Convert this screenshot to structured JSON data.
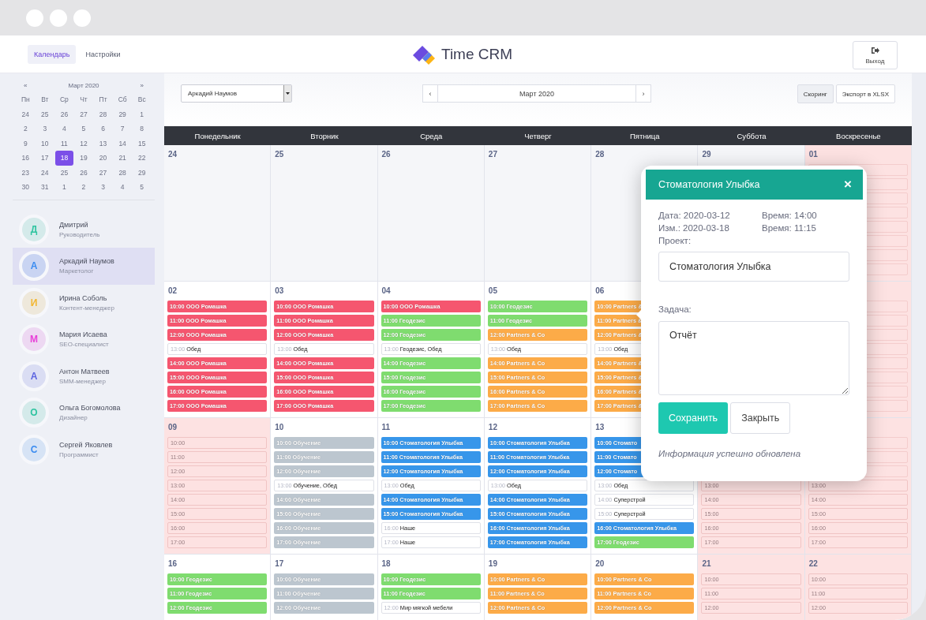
{
  "header": {
    "tabs": [
      {
        "label": "Календарь",
        "selected": true
      },
      {
        "label": "Настройки",
        "selected": false
      }
    ],
    "logo": "Time CRM",
    "exit": "Выход"
  },
  "sidebar": {
    "mini_calendar": {
      "prev": "«",
      "title": "Март 2020",
      "next": "»",
      "weekdays": [
        "Пн",
        "Вт",
        "Ср",
        "Чт",
        "Пт",
        "Сб",
        "Вс"
      ],
      "weeks": [
        [
          {
            "day": "24",
            "selected": false
          },
          {
            "day": "25",
            "selected": false
          },
          {
            "day": "26",
            "selected": false
          },
          {
            "day": "27",
            "selected": false
          },
          {
            "day": "28",
            "selected": false
          },
          {
            "day": "29",
            "selected": false
          },
          {
            "day": "1",
            "selected": false
          }
        ],
        [
          {
            "day": "2",
            "selected": false
          },
          {
            "day": "3",
            "selected": false
          },
          {
            "day": "4",
            "selected": false
          },
          {
            "day": "5",
            "selected": false
          },
          {
            "day": "6",
            "selected": false
          },
          {
            "day": "7",
            "selected": false
          },
          {
            "day": "8",
            "selected": false
          }
        ],
        [
          {
            "day": "9",
            "selected": false
          },
          {
            "day": "10",
            "selected": false
          },
          {
            "day": "11",
            "selected": false
          },
          {
            "day": "12",
            "selected": false
          },
          {
            "day": "13",
            "selected": false
          },
          {
            "day": "14",
            "selected": false
          },
          {
            "day": "15",
            "selected": false
          }
        ],
        [
          {
            "day": "16",
            "selected": false
          },
          {
            "day": "17",
            "selected": false
          },
          {
            "day": "18",
            "selected": true
          },
          {
            "day": "19",
            "selected": false
          },
          {
            "day": "20",
            "selected": false
          },
          {
            "day": "21",
            "selected": false
          },
          {
            "day": "22",
            "selected": false
          }
        ],
        [
          {
            "day": "23",
            "selected": false
          },
          {
            "day": "24",
            "selected": false
          },
          {
            "day": "25",
            "selected": false
          },
          {
            "day": "26",
            "selected": false
          },
          {
            "day": "27",
            "selected": false
          },
          {
            "day": "28",
            "selected": false
          },
          {
            "day": "29",
            "selected": false
          }
        ],
        [
          {
            "day": "30",
            "selected": false
          },
          {
            "day": "31",
            "selected": false
          },
          {
            "day": "1",
            "selected": false
          },
          {
            "day": "2",
            "selected": false
          },
          {
            "day": "3",
            "selected": false
          },
          {
            "day": "4",
            "selected": false
          },
          {
            "day": "5",
            "selected": false
          }
        ]
      ]
    },
    "users": [
      {
        "initial": "Д",
        "name": "Дмитрий",
        "role": "Руководитель",
        "color": "#2ec4a0",
        "selected": false
      },
      {
        "initial": "А",
        "name": "Аркадий Наумов",
        "role": "Маркетолог",
        "color": "#3b8cf0",
        "selected": true
      },
      {
        "initial": "И",
        "name": "Ирина Соболь",
        "role": "Контент-менеджер",
        "color": "#f2b630",
        "selected": false
      },
      {
        "initial": "М",
        "name": "Мария Исаева",
        "role": "SEO-специалист",
        "color": "#e83fd8",
        "selected": false
      },
      {
        "initial": "А",
        "name": "Антон Матвеев",
        "role": "SMM-менеджер",
        "color": "#5b63e0",
        "selected": false
      },
      {
        "initial": "О",
        "name": "Ольга Богомолова",
        "role": "Дизайнер",
        "color": "#2ec4a0",
        "selected": false
      },
      {
        "initial": "С",
        "name": "Сергей Яковлев",
        "role": "Программист",
        "color": "#3b8cf0",
        "selected": false
      }
    ]
  },
  "toolbar": {
    "user_select": "Аркадий Наумов",
    "month_prev": "‹",
    "month": "Март 2020",
    "month_next": "›",
    "buttons": [
      {
        "label": "Скоринг",
        "selected": true
      },
      {
        "label": "Экспорт в XLSX",
        "selected": false
      }
    ]
  },
  "calendar": {
    "weekdays": [
      "Понедельник",
      "Вторник",
      "Среда",
      "Четверг",
      "Пятница",
      "Суббота",
      "Воскресенье"
    ],
    "weeks": [
      {
        "days": [
          {
            "number": "24",
            "kind": "past"
          },
          {
            "number": "25",
            "kind": "past"
          },
          {
            "number": "26",
            "kind": "past"
          },
          {
            "number": "27",
            "kind": "past"
          },
          {
            "number": "28",
            "kind": "past"
          },
          {
            "number": "29",
            "kind": "past"
          },
          {
            "number": "01",
            "kind": "off",
            "events": [
              {
                "kind": "blank"
              },
              {
                "kind": "blank"
              },
              {
                "kind": "blank"
              },
              {
                "kind": "blank"
              },
              {
                "kind": "blank"
              },
              {
                "kind": "blank"
              },
              {
                "kind": "blank"
              },
              {
                "kind": "blank"
              }
            ]
          }
        ]
      },
      {
        "days": [
          {
            "number": "02",
            "kind": "work",
            "events": [
              {
                "kind": "busy",
                "time": "10:00",
                "title": "ООО Ромашка",
                "color": "#f5566f"
              },
              {
                "kind": "busy",
                "time": "11:00",
                "title": "ООО Ромашка",
                "color": "#f5566f"
              },
              {
                "kind": "busy",
                "time": "12:00",
                "title": "ООО Ромашка",
                "color": "#f5566f"
              },
              {
                "kind": "note",
                "time": "13:00",
                "title": "Обед"
              },
              {
                "kind": "busy",
                "time": "14:00",
                "title": "ООО Ромашка",
                "color": "#f5566f"
              },
              {
                "kind": "busy",
                "time": "15:00",
                "title": "ООО Ромашка",
                "color": "#f5566f"
              },
              {
                "kind": "busy",
                "time": "16:00",
                "title": "ООО Ромашка",
                "color": "#f5566f"
              },
              {
                "kind": "busy",
                "time": "17:00",
                "title": "ООО Ромашка",
                "color": "#f5566f"
              }
            ]
          },
          {
            "number": "03",
            "kind": "work",
            "events": [
              {
                "kind": "busy",
                "time": "10:00",
                "title": "ООО Ромашка",
                "color": "#f5566f"
              },
              {
                "kind": "busy",
                "time": "11:00",
                "title": "ООО Ромашка",
                "color": "#f5566f"
              },
              {
                "kind": "busy",
                "time": "12:00",
                "title": "ООО Ромашка",
                "color": "#f5566f"
              },
              {
                "kind": "note",
                "time": "13:00",
                "title": "Обед"
              },
              {
                "kind": "busy",
                "time": "14:00",
                "title": "ООО Ромашка",
                "color": "#f5566f"
              },
              {
                "kind": "busy",
                "time": "15:00",
                "title": "ООО Ромашка",
                "color": "#f5566f"
              },
              {
                "kind": "busy",
                "time": "16:00",
                "title": "ООО Ромашка",
                "color": "#f5566f"
              },
              {
                "kind": "busy",
                "time": "17:00",
                "title": "ООО Ромашка",
                "color": "#f5566f"
              }
            ]
          },
          {
            "number": "04",
            "kind": "work",
            "events": [
              {
                "kind": "busy",
                "time": "10:00",
                "title": "ООО Ромашка",
                "color": "#f5566f"
              },
              {
                "kind": "busy",
                "time": "11:00",
                "title": "Геодезис",
                "color": "#7fdc6f"
              },
              {
                "kind": "busy",
                "time": "12:00",
                "title": "Геодезис",
                "color": "#7fdc6f"
              },
              {
                "kind": "note",
                "time": "13:00",
                "title": "Геодезис, Обед"
              },
              {
                "kind": "busy",
                "time": "14:00",
                "title": "Геодезис",
                "color": "#7fdc6f"
              },
              {
                "kind": "busy",
                "time": "15:00",
                "title": "Геодезис",
                "color": "#7fdc6f"
              },
              {
                "kind": "busy",
                "time": "16:00",
                "title": "Геодезис",
                "color": "#7fdc6f"
              },
              {
                "kind": "busy",
                "time": "17:00",
                "title": "Геодезис",
                "color": "#7fdc6f"
              }
            ]
          },
          {
            "number": "05",
            "kind": "work",
            "events": [
              {
                "kind": "busy",
                "time": "10:00",
                "title": "Геодезис",
                "color": "#7fdc6f"
              },
              {
                "kind": "busy",
                "time": "11:00",
                "title": "Геодезис",
                "color": "#7fdc6f"
              },
              {
                "kind": "busy",
                "time": "12:00",
                "title": "Partners & Co",
                "color": "#fcab48"
              },
              {
                "kind": "note",
                "time": "13:00",
                "title": "Обед"
              },
              {
                "kind": "busy",
                "time": "14:00",
                "title": "Partners & Co",
                "color": "#fcab48"
              },
              {
                "kind": "busy",
                "time": "15:00",
                "title": "Partners & Co",
                "color": "#fcab48"
              },
              {
                "kind": "busy",
                "time": "16:00",
                "title": "Partners & Co",
                "color": "#fcab48"
              },
              {
                "kind": "busy",
                "time": "17:00",
                "title": "Partners & Co",
                "color": "#fcab48"
              }
            ]
          },
          {
            "number": "06",
            "kind": "work",
            "events": [
              {
                "kind": "busy",
                "time": "10:00",
                "title": "Partners &",
                "color": "#fcab48"
              },
              {
                "kind": "busy",
                "time": "11:00",
                "title": "Partners &",
                "color": "#fcab48"
              },
              {
                "kind": "busy",
                "time": "12:00",
                "title": "Partners &",
                "color": "#fcab48"
              },
              {
                "kind": "note",
                "time": "13:00",
                "title": "Обед"
              },
              {
                "kind": "busy",
                "time": "14:00",
                "title": "Partners &",
                "color": "#fcab48"
              },
              {
                "kind": "busy",
                "time": "15:00",
                "title": "Partners &",
                "color": "#fcab48"
              },
              {
                "kind": "busy",
                "time": "16:00",
                "title": "Partners &",
                "color": "#fcab48"
              },
              {
                "kind": "busy",
                "time": "17:00",
                "title": "Partners &",
                "color": "#fcab48"
              }
            ]
          },
          {
            "kind": "off"
          },
          {
            "kind": "off",
            "events": [
              {
                "kind": "blank"
              },
              {
                "kind": "blank"
              },
              {
                "kind": "blank"
              },
              {
                "kind": "blank"
              },
              {
                "kind": "blank"
              },
              {
                "kind": "blank"
              },
              {
                "kind": "blank"
              },
              {
                "kind": "blank"
              }
            ]
          }
        ]
      },
      {
        "days": [
          {
            "number": "09",
            "kind": "off",
            "events": [
              {
                "kind": "free",
                "time": "10:00"
              },
              {
                "kind": "free",
                "time": "11:00"
              },
              {
                "kind": "free",
                "time": "12:00"
              },
              {
                "kind": "free",
                "time": "13:00"
              },
              {
                "kind": "free",
                "time": "14:00"
              },
              {
                "kind": "free",
                "time": "15:00"
              },
              {
                "kind": "free",
                "time": "16:00"
              },
              {
                "kind": "free",
                "time": "17:00"
              }
            ]
          },
          {
            "number": "10",
            "kind": "work",
            "events": [
              {
                "kind": "busy",
                "time": "10:00",
                "title": "Обучение",
                "color": "#bcc6cf"
              },
              {
                "kind": "busy",
                "time": "11:00",
                "title": "Обучение",
                "color": "#bcc6cf"
              },
              {
                "kind": "busy",
                "time": "12:00",
                "title": "Обучение",
                "color": "#bcc6cf"
              },
              {
                "kind": "note",
                "time": "13:00",
                "title": "Обучение, Обед"
              },
              {
                "kind": "busy",
                "time": "14:00",
                "title": "Обучение",
                "color": "#bcc6cf"
              },
              {
                "kind": "busy",
                "time": "15:00",
                "title": "Обучение",
                "color": "#bcc6cf"
              },
              {
                "kind": "busy",
                "time": "16:00",
                "title": "Обучение",
                "color": "#bcc6cf"
              },
              {
                "kind": "busy",
                "time": "17:00",
                "title": "Обучение",
                "color": "#bcc6cf"
              }
            ]
          },
          {
            "number": "11",
            "kind": "work",
            "events": [
              {
                "kind": "busy",
                "time": "10:00",
                "title": "Стоматология Улыбка",
                "color": "#3796ea"
              },
              {
                "kind": "busy",
                "time": "11:00",
                "title": "Стоматология Улыбка",
                "color": "#3796ea"
              },
              {
                "kind": "busy",
                "time": "12:00",
                "title": "Стоматология Улыбка",
                "color": "#3796ea"
              },
              {
                "kind": "note",
                "time": "13:00",
                "title": "Обед"
              },
              {
                "kind": "busy",
                "time": "14:00",
                "title": "Стоматология Улыбка",
                "color": "#3796ea"
              },
              {
                "kind": "busy",
                "time": "15:00",
                "title": "Стоматология Улыбка",
                "color": "#3796ea"
              },
              {
                "kind": "note",
                "time": "16:00",
                "title": "Наше"
              },
              {
                "kind": "note",
                "time": "17:00",
                "title": "Наше"
              }
            ]
          },
          {
            "number": "12",
            "kind": "work",
            "events": [
              {
                "kind": "busy",
                "time": "10:00",
                "title": "Стоматология Улыбка",
                "color": "#3796ea"
              },
              {
                "kind": "busy",
                "time": "11:00",
                "title": "Стоматология Улыбка",
                "color": "#3796ea"
              },
              {
                "kind": "busy",
                "time": "12:00",
                "title": "Стоматология Улыбка",
                "color": "#3796ea"
              },
              {
                "kind": "note",
                "time": "13:00",
                "title": "Обед"
              },
              {
                "kind": "busy",
                "time": "14:00",
                "title": "Стоматология Улыбка",
                "color": "#3796ea"
              },
              {
                "kind": "busy",
                "time": "15:00",
                "title": "Стоматология Улыбка",
                "color": "#3796ea"
              },
              {
                "kind": "busy",
                "time": "16:00",
                "title": "Стоматология Улыбка",
                "color": "#3796ea"
              },
              {
                "kind": "busy",
                "time": "17:00",
                "title": "Стоматология Улыбка",
                "color": "#3796ea"
              }
            ]
          },
          {
            "number": "13",
            "kind": "work",
            "events": [
              {
                "kind": "busy",
                "time": "10:00",
                "title": "Стомато",
                "color": "#3796ea"
              },
              {
                "kind": "busy",
                "time": "11:00",
                "title": "Стомато",
                "color": "#3796ea"
              },
              {
                "kind": "busy",
                "time": "12:00",
                "title": "Стомато",
                "color": "#3796ea"
              },
              {
                "kind": "note",
                "time": "13:00",
                "title": "Обед"
              },
              {
                "kind": "note",
                "time": "14:00",
                "title": "Суперстрой"
              },
              {
                "kind": "note",
                "time": "15:00",
                "title": "Суперстрой"
              },
              {
                "kind": "busy",
                "time": "16:00",
                "title": "Стоматология Улыбка",
                "color": "#3796ea"
              },
              {
                "kind": "busy",
                "time": "17:00",
                "title": "Геодезис",
                "color": "#7fdc6f"
              }
            ]
          },
          {
            "kind": "off",
            "events": [
              {
                "kind": "covered"
              },
              {
                "kind": "covered"
              },
              {
                "kind": "covered"
              },
              {
                "kind": "free",
                "time": "13:00"
              },
              {
                "kind": "free",
                "time": "14:00"
              },
              {
                "kind": "free",
                "time": "15:00"
              },
              {
                "kind": "free",
                "time": "16:00"
              },
              {
                "kind": "free",
                "time": "17:00"
              }
            ]
          },
          {
            "kind": "off",
            "events": [
              {
                "kind": "blank"
              },
              {
                "kind": "blank"
              },
              {
                "kind": "blank"
              },
              {
                "kind": "free",
                "time": "13:00"
              },
              {
                "kind": "free",
                "time": "14:00"
              },
              {
                "kind": "free",
                "time": "15:00"
              },
              {
                "kind": "free",
                "time": "16:00"
              },
              {
                "kind": "free",
                "time": "17:00"
              }
            ]
          }
        ]
      },
      {
        "days": [
          {
            "number": "16",
            "kind": "work",
            "events": [
              {
                "kind": "busy",
                "time": "10:00",
                "title": "Геодезис",
                "color": "#7fdc6f"
              },
              {
                "kind": "busy",
                "time": "11:00",
                "title": "Геодезис",
                "color": "#7fdc6f"
              },
              {
                "kind": "busy",
                "time": "12:00",
                "title": "Геодезис",
                "color": "#7fdc6f"
              }
            ]
          },
          {
            "number": "17",
            "kind": "work",
            "events": [
              {
                "kind": "busy",
                "time": "10:00",
                "title": "Обучение",
                "color": "#bcc6cf"
              },
              {
                "kind": "busy",
                "time": "11:00",
                "title": "Обучение",
                "color": "#bcc6cf"
              },
              {
                "kind": "busy",
                "time": "12:00",
                "title": "Обучение",
                "color": "#bcc6cf"
              }
            ]
          },
          {
            "number": "18",
            "kind": "work",
            "events": [
              {
                "kind": "busy",
                "time": "10:00",
                "title": "Геодезис",
                "color": "#7fdc6f"
              },
              {
                "kind": "busy",
                "time": "11:00",
                "title": "Геодезис",
                "color": "#7fdc6f"
              },
              {
                "kind": "note",
                "time": "12:00",
                "title": "Мир мягкой мебели"
              }
            ]
          },
          {
            "number": "19",
            "kind": "work",
            "events": [
              {
                "kind": "busy",
                "time": "10:00",
                "title": "Partners & Co",
                "color": "#fcab48"
              },
              {
                "kind": "busy",
                "time": "11:00",
                "title": "Partners & Co",
                "color": "#fcab48"
              },
              {
                "kind": "busy",
                "time": "12:00",
                "title": "Partners & Co",
                "color": "#fcab48"
              }
            ]
          },
          {
            "number": "20",
            "kind": "work",
            "events": [
              {
                "kind": "busy",
                "time": "10:00",
                "title": "Partners & Co",
                "color": "#fcab48"
              },
              {
                "kind": "busy",
                "time": "11:00",
                "title": "Partners & Co",
                "color": "#fcab48"
              },
              {
                "kind": "busy",
                "time": "12:00",
                "title": "Partners & Co",
                "color": "#fcab48"
              }
            ]
          },
          {
            "number": "21",
            "kind": "off",
            "events": [
              {
                "kind": "free",
                "time": "10:00"
              },
              {
                "kind": "free",
                "time": "11:00"
              },
              {
                "kind": "free",
                "time": "12:00"
              }
            ]
          },
          {
            "number": "22",
            "kind": "off",
            "events": [
              {
                "kind": "free",
                "time": "10:00"
              },
              {
                "kind": "free",
                "time": "11:00"
              },
              {
                "kind": "free",
                "time": "12:00"
              }
            ]
          }
        ]
      }
    ]
  },
  "popup": {
    "title": "Стоматология Улыбка",
    "close": "×",
    "meta": [
      "Дата: 2020-03-12",
      "Время: 14:00",
      "Изм.: 2020-03-18",
      "Время: 11:15"
    ],
    "project_label": "Проект:",
    "project": "Стоматология Улыбка",
    "task_label": "Задача:",
    "task": "Отчёт",
    "buttons": [
      {
        "kind": "primary",
        "label": "Сохранить"
      },
      {
        "kind": "secondary",
        "label": "Закрыть"
      }
    ],
    "message": "Информация успешно обновлена"
  }
}
